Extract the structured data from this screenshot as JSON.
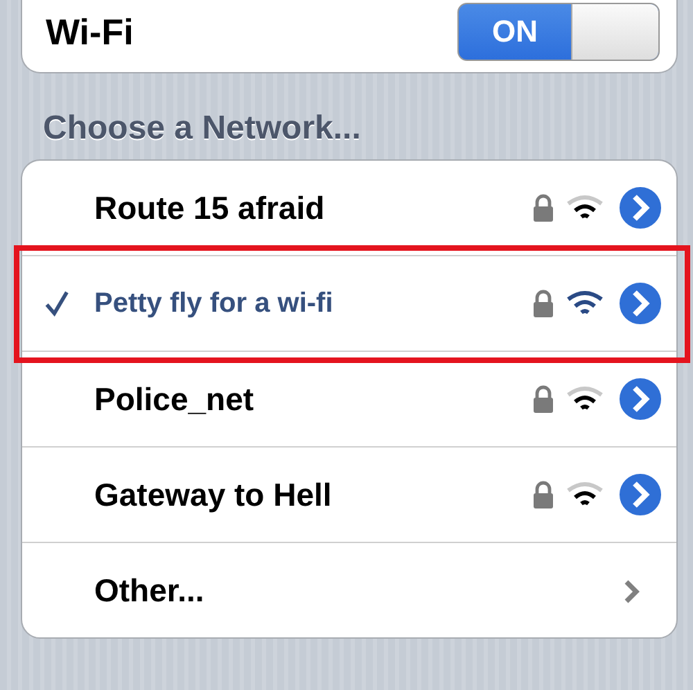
{
  "wifi": {
    "label": "Wi-Fi",
    "on": true,
    "on_text": "ON"
  },
  "section_header": "Choose a Network...",
  "networks": [
    {
      "kind": "network",
      "name": "Route 15 afraid",
      "selected": false,
      "locked": true,
      "highlighted": false
    },
    {
      "kind": "network",
      "name": "Petty fly for a wi-fi",
      "selected": true,
      "locked": true,
      "highlighted": true
    },
    {
      "kind": "network",
      "name": "Police_net",
      "selected": false,
      "locked": true,
      "highlighted": false
    },
    {
      "kind": "network",
      "name": "Gateway to Hell",
      "selected": false,
      "locked": true,
      "highlighted": false
    },
    {
      "kind": "other",
      "name": "Other..."
    }
  ]
}
